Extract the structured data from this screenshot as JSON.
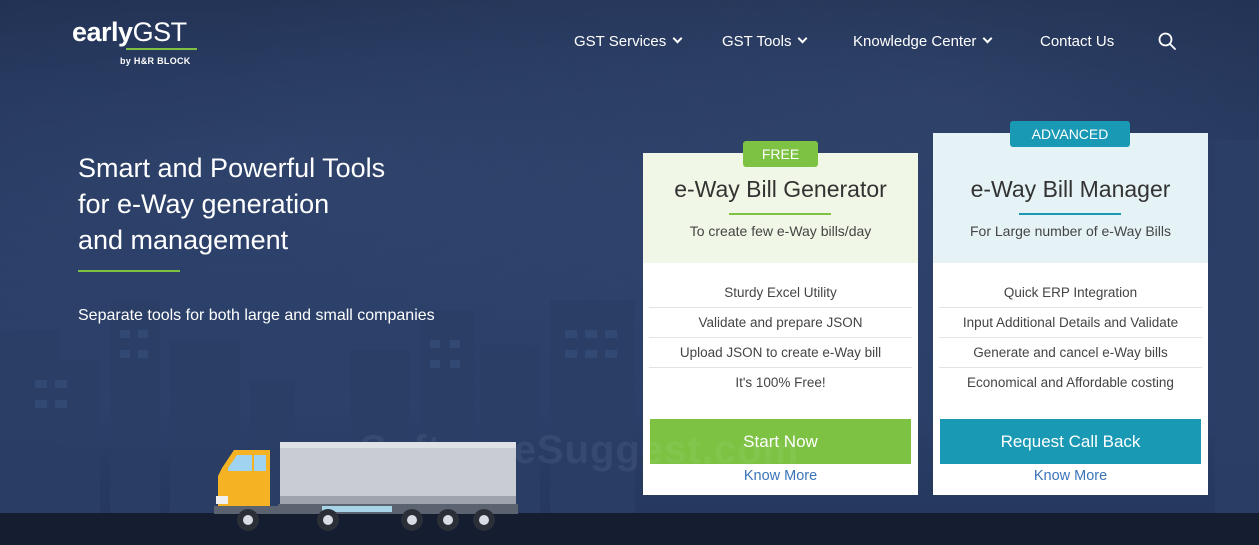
{
  "header": {
    "logo": {
      "word_bold": "early",
      "word_light": "GST",
      "sub": "by H&R BLOCK"
    },
    "nav": [
      {
        "label": "GST Services"
      },
      {
        "label": "GST Tools"
      },
      {
        "label": "Knowledge Center"
      },
      {
        "label": "Contact Us"
      }
    ]
  },
  "hero": {
    "title_line1": "Smart and Powerful Tools",
    "title_line2": "for e-Way generation",
    "title_line3": "and management",
    "subtitle": "Separate tools for both large and small companies"
  },
  "cards": [
    {
      "badge": "FREE",
      "title": "e-Way Bill Generator",
      "tagline": "To create few e-Way bills/day",
      "features": [
        "Sturdy Excel Utility",
        "Validate and prepare JSON",
        "Upload JSON to create e-Way bill",
        "It's 100% Free!"
      ],
      "cta": "Start Now",
      "link": "Know More"
    },
    {
      "badge": "ADVANCED",
      "title": "e-Way Bill Manager",
      "tagline": "For Large number of e-Way Bills",
      "features": [
        "Quick ERP Integration",
        "Input Additional Details and Validate",
        "Generate and cancel e-Way bills",
        "Economical and Affordable costing"
      ],
      "cta": "Request Call Back",
      "link": "Know More"
    }
  ],
  "watermark": "SoftwareSuggest.com",
  "colors": {
    "accent_green": "#7dc242",
    "accent_teal": "#1a99b5",
    "link_blue": "#3a74b8",
    "card1_head_bg": "#f1f7e6",
    "card2_head_bg": "#e6f3f6"
  }
}
